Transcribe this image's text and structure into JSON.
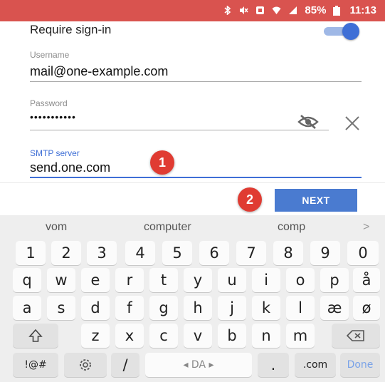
{
  "status_bar": {
    "battery": "85%",
    "time": "11:13",
    "icons": [
      "bluetooth-icon",
      "mute-icon",
      "nfc-icon",
      "wifi-icon",
      "signal-icon",
      "battery-icon"
    ]
  },
  "form": {
    "require_signin_label": "Require sign-in",
    "require_signin_on": true,
    "username_label": "Username",
    "username_value": "mail@one-example.com",
    "password_label": "Password",
    "password_value": "•••••••••••",
    "smtp_label": "SMTP server",
    "smtp_value": "send.one.com",
    "badge_1": "1",
    "badge_2": "2"
  },
  "actions": {
    "next_label": "NEXT"
  },
  "keyboard": {
    "suggestions": [
      "vom",
      "computer",
      "comp"
    ],
    "more_suggestions": ">",
    "row_numbers": [
      "1",
      "2",
      "3",
      "4",
      "5",
      "6",
      "7",
      "8",
      "9",
      "0"
    ],
    "row1": [
      "q",
      "w",
      "e",
      "r",
      "t",
      "y",
      "u",
      "i",
      "o",
      "p",
      "å"
    ],
    "row2": [
      "a",
      "s",
      "d",
      "f",
      "g",
      "h",
      "j",
      "k",
      "l",
      "æ",
      "ø"
    ],
    "row3": [
      "z",
      "x",
      "c",
      "v",
      "b",
      "n",
      "m"
    ],
    "symbols_key": "!@#",
    "slash_key": "/",
    "space_label": "◂ DA ▸",
    "dot_key": ".",
    "com_key": ".com",
    "done_key": "Done"
  },
  "colors": {
    "status_bar": "#d9534f",
    "accent_blue": "#3f6fd6",
    "next_button": "#4a7bd0",
    "badge_red": "#e03b32"
  }
}
